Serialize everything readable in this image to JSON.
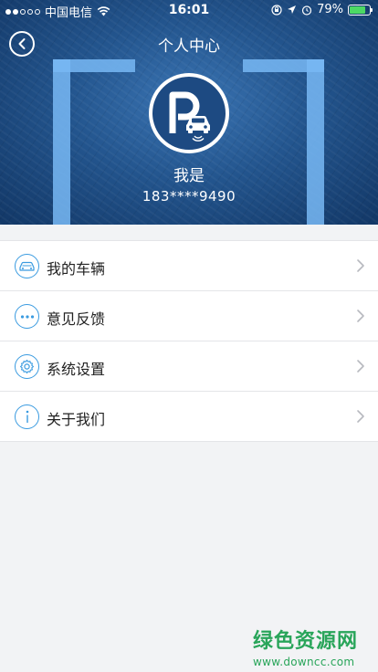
{
  "status_bar": {
    "carrier": "中国电信",
    "time": "16:01",
    "battery_percent": "79%",
    "battery_level": 0.79,
    "icons": [
      "signal-dots-icon",
      "wifi-icon",
      "orientation-lock-icon",
      "location-arrow-icon",
      "alarm-icon"
    ]
  },
  "header": {
    "title": "个人中心",
    "back_icon": "back-chevron-icon"
  },
  "profile": {
    "logo_icon": "parking-car-logo-icon",
    "name": "我是",
    "phone": "183****9490"
  },
  "menu": {
    "items": [
      {
        "label": "我的车辆",
        "icon": "car-icon"
      },
      {
        "label": "意见反馈",
        "icon": "ellipsis-icon"
      },
      {
        "label": "系统设置",
        "icon": "gear-icon"
      },
      {
        "label": "关于我们",
        "icon": "info-icon"
      }
    ]
  },
  "watermark": {
    "title": "绿色资源网",
    "url": "www.downcc.com"
  },
  "colors": {
    "accent": "#3a9be0",
    "hero": "#23558e",
    "watermark": "#29a55a"
  }
}
